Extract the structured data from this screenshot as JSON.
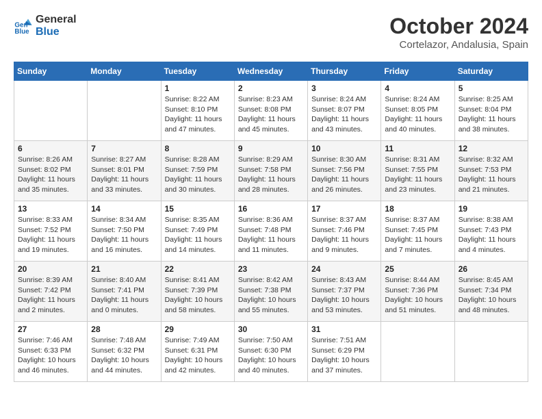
{
  "logo": {
    "line1": "General",
    "line2": "Blue"
  },
  "title": "October 2024",
  "location": "Cortelazor, Andalusia, Spain",
  "weekdays": [
    "Sunday",
    "Monday",
    "Tuesday",
    "Wednesday",
    "Thursday",
    "Friday",
    "Saturday"
  ],
  "weeks": [
    [
      null,
      null,
      {
        "day": 1,
        "sunrise": "8:22 AM",
        "sunset": "8:10 PM",
        "daylight": "11 hours and 47 minutes."
      },
      {
        "day": 2,
        "sunrise": "8:23 AM",
        "sunset": "8:08 PM",
        "daylight": "11 hours and 45 minutes."
      },
      {
        "day": 3,
        "sunrise": "8:24 AM",
        "sunset": "8:07 PM",
        "daylight": "11 hours and 43 minutes."
      },
      {
        "day": 4,
        "sunrise": "8:24 AM",
        "sunset": "8:05 PM",
        "daylight": "11 hours and 40 minutes."
      },
      {
        "day": 5,
        "sunrise": "8:25 AM",
        "sunset": "8:04 PM",
        "daylight": "11 hours and 38 minutes."
      }
    ],
    [
      {
        "day": 6,
        "sunrise": "8:26 AM",
        "sunset": "8:02 PM",
        "daylight": "11 hours and 35 minutes."
      },
      {
        "day": 7,
        "sunrise": "8:27 AM",
        "sunset": "8:01 PM",
        "daylight": "11 hours and 33 minutes."
      },
      {
        "day": 8,
        "sunrise": "8:28 AM",
        "sunset": "7:59 PM",
        "daylight": "11 hours and 30 minutes."
      },
      {
        "day": 9,
        "sunrise": "8:29 AM",
        "sunset": "7:58 PM",
        "daylight": "11 hours and 28 minutes."
      },
      {
        "day": 10,
        "sunrise": "8:30 AM",
        "sunset": "7:56 PM",
        "daylight": "11 hours and 26 minutes."
      },
      {
        "day": 11,
        "sunrise": "8:31 AM",
        "sunset": "7:55 PM",
        "daylight": "11 hours and 23 minutes."
      },
      {
        "day": 12,
        "sunrise": "8:32 AM",
        "sunset": "7:53 PM",
        "daylight": "11 hours and 21 minutes."
      }
    ],
    [
      {
        "day": 13,
        "sunrise": "8:33 AM",
        "sunset": "7:52 PM",
        "daylight": "11 hours and 19 minutes."
      },
      {
        "day": 14,
        "sunrise": "8:34 AM",
        "sunset": "7:50 PM",
        "daylight": "11 hours and 16 minutes."
      },
      {
        "day": 15,
        "sunrise": "8:35 AM",
        "sunset": "7:49 PM",
        "daylight": "11 hours and 14 minutes."
      },
      {
        "day": 16,
        "sunrise": "8:36 AM",
        "sunset": "7:48 PM",
        "daylight": "11 hours and 11 minutes."
      },
      {
        "day": 17,
        "sunrise": "8:37 AM",
        "sunset": "7:46 PM",
        "daylight": "11 hours and 9 minutes."
      },
      {
        "day": 18,
        "sunrise": "8:37 AM",
        "sunset": "7:45 PM",
        "daylight": "11 hours and 7 minutes."
      },
      {
        "day": 19,
        "sunrise": "8:38 AM",
        "sunset": "7:43 PM",
        "daylight": "11 hours and 4 minutes."
      }
    ],
    [
      {
        "day": 20,
        "sunrise": "8:39 AM",
        "sunset": "7:42 PM",
        "daylight": "11 hours and 2 minutes."
      },
      {
        "day": 21,
        "sunrise": "8:40 AM",
        "sunset": "7:41 PM",
        "daylight": "11 hours and 0 minutes."
      },
      {
        "day": 22,
        "sunrise": "8:41 AM",
        "sunset": "7:39 PM",
        "daylight": "10 hours and 58 minutes."
      },
      {
        "day": 23,
        "sunrise": "8:42 AM",
        "sunset": "7:38 PM",
        "daylight": "10 hours and 55 minutes."
      },
      {
        "day": 24,
        "sunrise": "8:43 AM",
        "sunset": "7:37 PM",
        "daylight": "10 hours and 53 minutes."
      },
      {
        "day": 25,
        "sunrise": "8:44 AM",
        "sunset": "7:36 PM",
        "daylight": "10 hours and 51 minutes."
      },
      {
        "day": 26,
        "sunrise": "8:45 AM",
        "sunset": "7:34 PM",
        "daylight": "10 hours and 48 minutes."
      }
    ],
    [
      {
        "day": 27,
        "sunrise": "7:46 AM",
        "sunset": "6:33 PM",
        "daylight": "10 hours and 46 minutes."
      },
      {
        "day": 28,
        "sunrise": "7:48 AM",
        "sunset": "6:32 PM",
        "daylight": "10 hours and 44 minutes."
      },
      {
        "day": 29,
        "sunrise": "7:49 AM",
        "sunset": "6:31 PM",
        "daylight": "10 hours and 42 minutes."
      },
      {
        "day": 30,
        "sunrise": "7:50 AM",
        "sunset": "6:30 PM",
        "daylight": "10 hours and 40 minutes."
      },
      {
        "day": 31,
        "sunrise": "7:51 AM",
        "sunset": "6:29 PM",
        "daylight": "10 hours and 37 minutes."
      },
      null,
      null
    ]
  ]
}
